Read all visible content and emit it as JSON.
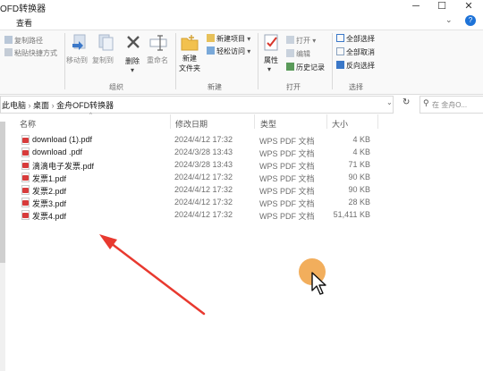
{
  "window": {
    "title": "OFD转换器",
    "controls": {
      "minimize": "─",
      "maximize": "☐",
      "close": "✕"
    }
  },
  "tabs": {
    "view": "查看"
  },
  "ribbon": {
    "clipboard": {
      "copy_path": "复制路径",
      "paste_shortcut": "粘贴快捷方式"
    },
    "organize": {
      "move_to": "移动到",
      "copy_to": "复制到",
      "delete": "删除",
      "rename": "重命名",
      "group_label": "组织"
    },
    "new": {
      "new_folder_line1": "新建",
      "new_folder_line2": "文件夹",
      "new_item": "新建项目",
      "easy_access": "轻松访问",
      "group_label": "新建"
    },
    "open": {
      "properties": "属性",
      "open": "打开",
      "edit": "编辑",
      "history": "历史记录",
      "group_label": "打开"
    },
    "select": {
      "select_all": "全部选择",
      "select_none": "全部取消",
      "invert": "反向选择",
      "group_label": "选择"
    }
  },
  "address": {
    "crumbs": [
      "此电脑",
      "桌面",
      "金舟OFD转换器"
    ],
    "separator": "›",
    "search_placeholder": "在 金舟O..."
  },
  "list": {
    "columns": {
      "name": "名称",
      "date": "修改日期",
      "type": "类型",
      "size": "大小"
    },
    "files": [
      {
        "name": "download (1).pdf",
        "date": "2024/4/12 17:32",
        "type": "WPS PDF 文档",
        "size": "4 KB"
      },
      {
        "name": "download .pdf",
        "date": "2024/3/28 13:43",
        "type": "WPS PDF 文档",
        "size": "4 KB"
      },
      {
        "name": "滴滴电子发票.pdf",
        "date": "2024/3/28 13:43",
        "type": "WPS PDF 文档",
        "size": "71 KB"
      },
      {
        "name": "发票1.pdf",
        "date": "2024/4/12 17:32",
        "type": "WPS PDF 文档",
        "size": "90 KB"
      },
      {
        "name": "发票2.pdf",
        "date": "2024/4/12 17:32",
        "type": "WPS PDF 文档",
        "size": "90 KB"
      },
      {
        "name": "发票3.pdf",
        "date": "2024/4/12 17:32",
        "type": "WPS PDF 文档",
        "size": "28 KB"
      },
      {
        "name": "发票4.pdf",
        "date": "2024/4/12 17:32",
        "type": "WPS PDF 文档",
        "size": "51,411 KB"
      }
    ]
  },
  "colors": {
    "annotation_arrow": "#e8392f",
    "cursor_highlight": "#f0a040",
    "pdf_icon": "#d83b3b",
    "accent": "#1e73d8"
  }
}
